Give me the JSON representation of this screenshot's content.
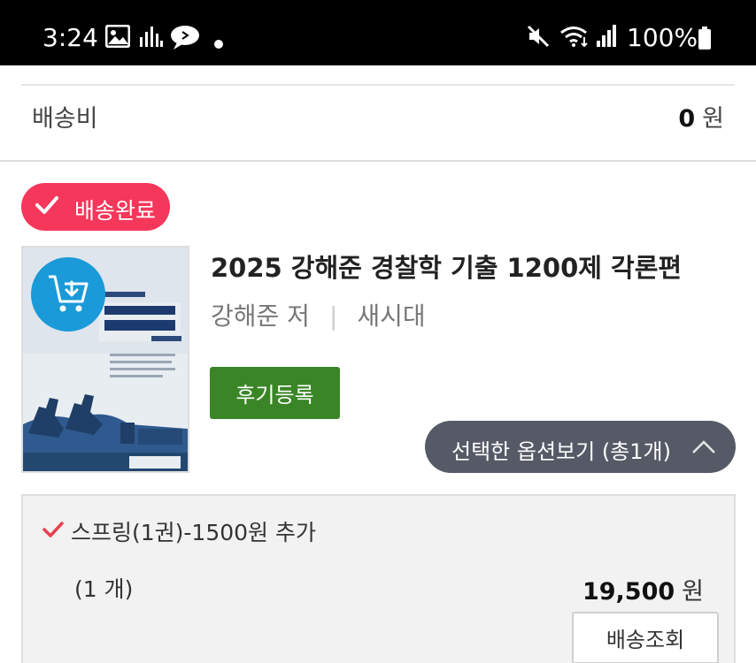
{
  "status_bar": {
    "time": "3:24",
    "battery": "100%",
    "left_icons": [
      "gallery-icon",
      "signal-bars-icon",
      "chat-bubble-icon",
      "dot-icon"
    ],
    "right_icons": [
      "mute-icon",
      "wifi-icon",
      "cell-signal-icon",
      "battery-icon"
    ]
  },
  "summary": {
    "shipping_label": "배송비",
    "shipping_amount": "0",
    "shipping_unit": "원"
  },
  "order": {
    "status_badge": "배송완료",
    "badge_color": "#f5375b",
    "product": {
      "title": "2025 강해준 경찰학 기출 1200제 각론편",
      "author": "강해준 저",
      "publisher": "새시대"
    },
    "review_button": "후기등록",
    "options_toggle": "선택한 옵션보기 (총1개)",
    "option": {
      "name": "스프링(1권)-1500원 추가",
      "quantity": "(1 개)",
      "price": "19,500",
      "price_unit": "원"
    },
    "track_button": "배송조회"
  },
  "colors": {
    "review_button": "#3a8626",
    "options_toggle": "#555a66",
    "cart_button": "#1a9ad8"
  }
}
